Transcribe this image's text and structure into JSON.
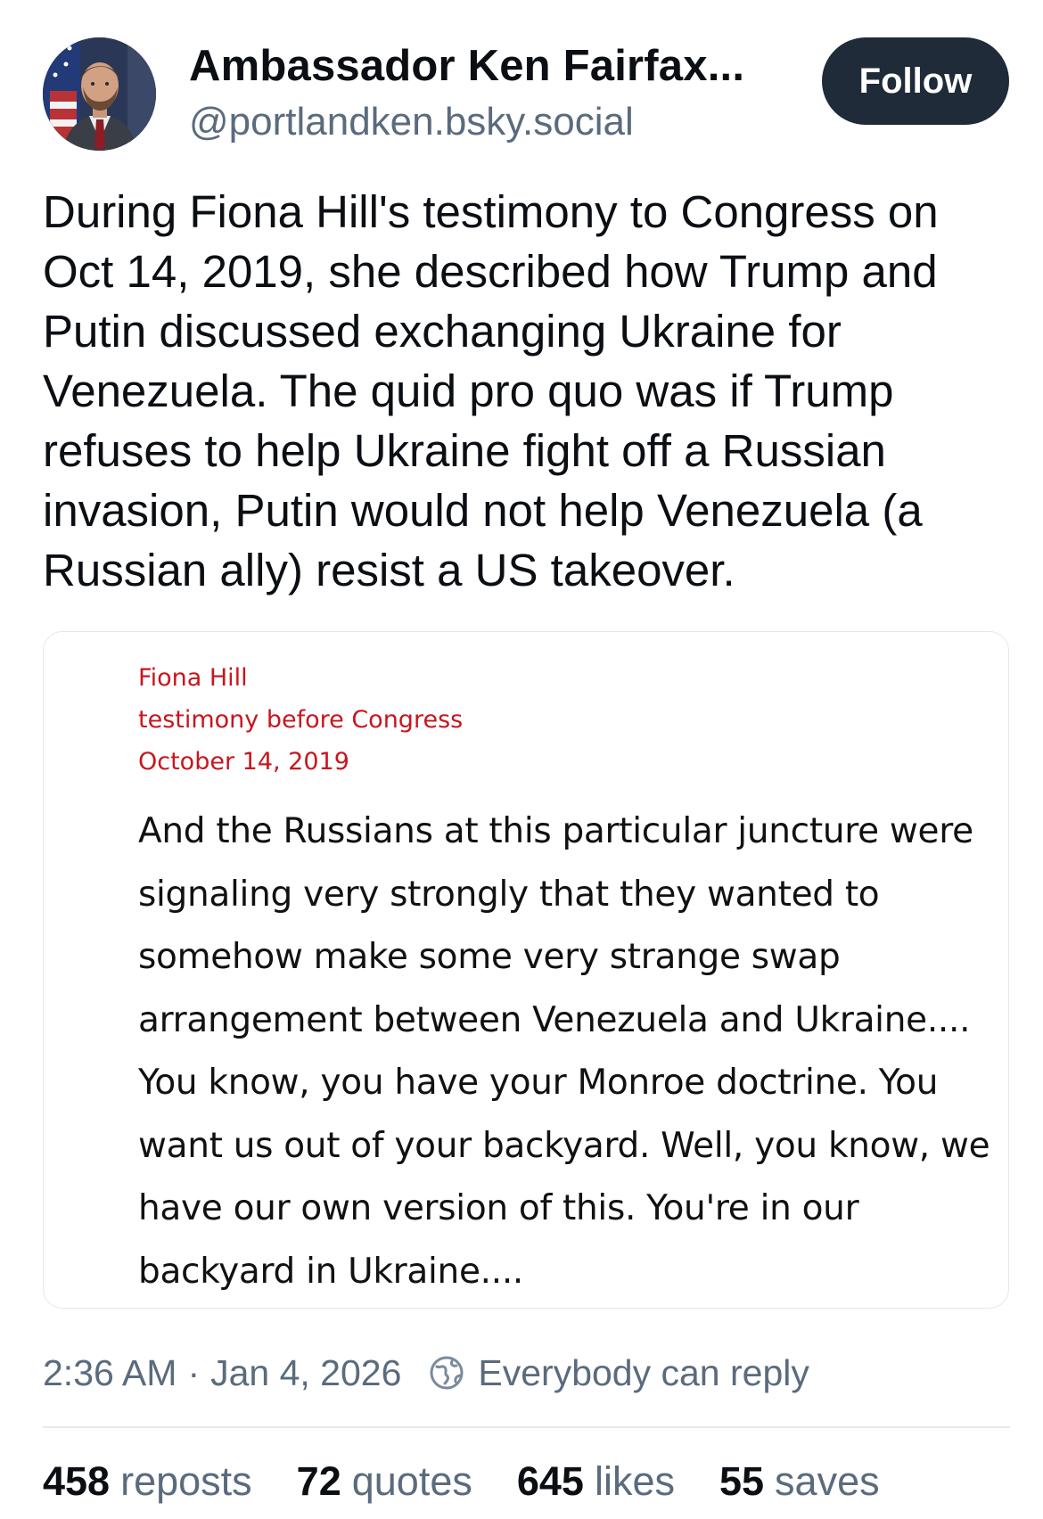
{
  "author": {
    "display_name": "Ambassador Ken Fairfax...",
    "handle": "@portlandken.bsky.social",
    "avatar_icon": "profile-photo"
  },
  "follow_label": "Follow",
  "post": {
    "text": "During Fiona Hill's testimony to Congress on Oct 14, 2019, she described how Trump and Putin discussed exchanging Ukraine for Venezuela. The quid pro quo was if Trump refuses to help Ukraine fight off a Russian invasion, Putin would not help Venezuela (a Russian ally) resist a US takeover."
  },
  "embed": {
    "cite_name": "Fiona Hill",
    "cite_context": "testimony before Congress",
    "cite_date": "October 14, 2019",
    "cite_color": "#c8161d",
    "quote": "And the Russians at this particular juncture were signaling very strongly that they wanted to somehow make some very strange swap arrangement between Venezuela and Ukraine.... You know, you have your Monroe doctrine. You want us out of your backyard. Well, you know, we have our own version of this. You're in our backyard in Ukraine...."
  },
  "meta": {
    "time": "2:36 AM",
    "separator": "·",
    "date": "Jan 4, 2026",
    "reply_setting": "Everybody can reply",
    "reply_icon": "globe-icon"
  },
  "stats": {
    "reposts_count": "458",
    "reposts_label": "reposts",
    "quotes_count": "72",
    "quotes_label": "quotes",
    "likes_count": "645",
    "likes_label": "likes",
    "saves_count": "55",
    "saves_label": "saves"
  },
  "colors": {
    "follow_button_bg": "#1f2b38",
    "muted_text": "#5b6b7e",
    "primary_text": "#0b0f14"
  }
}
